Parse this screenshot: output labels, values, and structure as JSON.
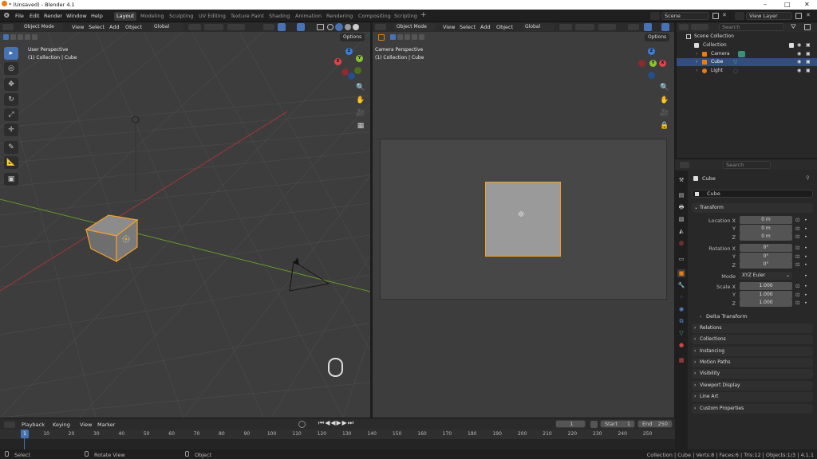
{
  "window": {
    "title": "* (Unsaved) - Blender 4.1"
  },
  "menubar": {
    "menus": [
      "File",
      "Edit",
      "Render",
      "Window",
      "Help"
    ],
    "workspaces": [
      "Layout",
      "Modeling",
      "Sculpting",
      "UV Editing",
      "Texture Paint",
      "Shading",
      "Animation",
      "Rendering",
      "Compositing",
      "Scripting"
    ],
    "active_workspace": "Layout",
    "scene": "Scene",
    "view_layer": "View Layer"
  },
  "viewport_left": {
    "mode": "Object Mode",
    "menus": [
      "View",
      "Select",
      "Add",
      "Object"
    ],
    "transform_orientation": "Global",
    "options": "Options",
    "overlay_title": "User Perspective",
    "overlay_collection": "(1) Collection | Cube"
  },
  "viewport_right": {
    "mode": "Object Mode",
    "menus": [
      "View",
      "Select",
      "Add",
      "Object"
    ],
    "transform_orientation": "Global",
    "options": "Options",
    "overlay_title": "Camera Perspective",
    "overlay_collection": "(1) Collection | Cube"
  },
  "gizmo": {
    "x": "X",
    "y": "Y",
    "z": "Z",
    "colors": {
      "x": "#e2424b",
      "y": "#8ac234",
      "z": "#3a7fd9"
    }
  },
  "outliner": {
    "search_placeholder": "Search",
    "root": "Scene Collection",
    "collection": "Collection",
    "items": [
      {
        "label": "Camera"
      },
      {
        "label": "Cube",
        "selected": true
      },
      {
        "label": "Light"
      }
    ]
  },
  "properties": {
    "search_placeholder": "Search",
    "object_name": "Cube",
    "data_name": "Cube",
    "transform": {
      "title": "Transform",
      "location_label": "Location X",
      "location": [
        "0 m",
        "0 m",
        "0 m"
      ],
      "rotation_label": "Rotation X",
      "rotation": [
        "0°",
        "0°",
        "0°"
      ],
      "mode_label": "Mode",
      "mode": "XYZ Euler",
      "scale_label": "Scale X",
      "scale": [
        "1.000",
        "1.000",
        "1.000"
      ],
      "y": "Y",
      "z": "Z",
      "delta": "Delta Transform"
    },
    "panels": [
      "Relations",
      "Collections",
      "Instancing",
      "Motion Paths",
      "Visibility",
      "Viewport Display",
      "Line Art",
      "Custom Properties"
    ]
  },
  "timeline": {
    "menus": [
      "Playback",
      "Keying",
      "View",
      "Marker"
    ],
    "current_frame": "1",
    "start_label": "Start",
    "start": "1",
    "end_label": "End",
    "end": "250",
    "ticks": [
      "1",
      "10",
      "20",
      "30",
      "40",
      "50",
      "60",
      "70",
      "80",
      "90",
      "100",
      "110",
      "120",
      "130",
      "140",
      "150",
      "160",
      "170",
      "180",
      "190",
      "200",
      "210",
      "220",
      "230",
      "240",
      "250"
    ],
    "playhead": "1"
  },
  "statusbar": {
    "hints": [
      "Select",
      "Rotate View",
      "Object"
    ],
    "stats": "Collection | Cube | Verts:8 | Faces:6 | Tris:12 | Objects:1/3 | 4.1.1"
  },
  "colors": {
    "accent": "#4772b3",
    "selection": "#f2a02c",
    "bg": "#3d3d3d"
  }
}
